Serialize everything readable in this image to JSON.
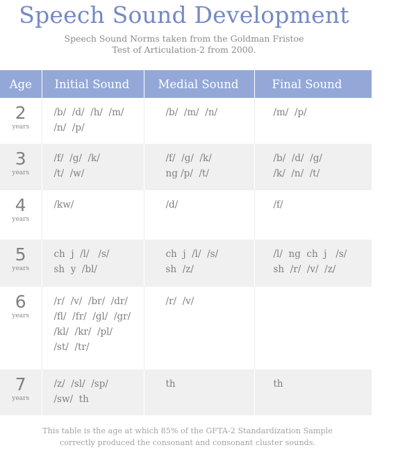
{
  "title": "Speech Sound Development",
  "subtitle": [
    "Speech Sound Norms taken from the Goldman Fristoe",
    "Test of Articulation-2 from 2000."
  ],
  "colors": {
    "accent": "#7589c3",
    "header_bg": "#94a8d8",
    "stripe_bg": "#f0f0f0",
    "text": "#7d7d7d"
  },
  "table": {
    "headers": {
      "age": "Age",
      "initial": "Initial Sound",
      "medial": "Medial Sound",
      "final": "Final Sound"
    },
    "rows": [
      {
        "age": "2",
        "unit": "years",
        "initial": [
          "/b/  /d/  /h/  /m/",
          "/n/  /p/"
        ],
        "medial": [
          "/b/  /m/  /n/"
        ],
        "final": [
          "/m/  /p/"
        ]
      },
      {
        "age": "3",
        "unit": "years",
        "initial": [
          "/f/  /g/  /k/",
          "/t/  /w/"
        ],
        "medial": [
          "/f/  /g/  /k/",
          "ng /p/  /t/"
        ],
        "final": [
          "/b/  /d/  /g/",
          "/k/  /n/  /t/"
        ]
      },
      {
        "age": "4",
        "unit": "years",
        "initial": [
          "/kw/"
        ],
        "medial": [
          "/d/"
        ],
        "final": [
          "/f/"
        ]
      },
      {
        "age": "5",
        "unit": "years",
        "initial": [
          "ch  j  /l/   /s/",
          "sh  y  /bl/"
        ],
        "medial": [
          "ch  j  /l/  /s/",
          "sh  /z/"
        ],
        "final": [
          "/l/  ng  ch  j   /s/",
          "sh  /r/  /v/  /z/"
        ]
      },
      {
        "age": "6",
        "unit": "years",
        "initial": [
          "/r/  /v/  /br/  /dr/",
          "/fl/  /fr/  /gl/  /gr/",
          "/kl/  /kr/  /pl/",
          "/st/  /tr/"
        ],
        "medial": [
          "/r/  /v/"
        ],
        "final": []
      },
      {
        "age": "7",
        "unit": "years",
        "initial": [
          "/z/  /sl/  /sp/",
          "/sw/  th"
        ],
        "medial": [
          "th"
        ],
        "final": [
          "th"
        ]
      }
    ]
  },
  "footnote": [
    "This table is the age at which 85% of the GFTA-2 Standardization Sample",
    "correctly produced the consonant and consonant cluster sounds."
  ]
}
